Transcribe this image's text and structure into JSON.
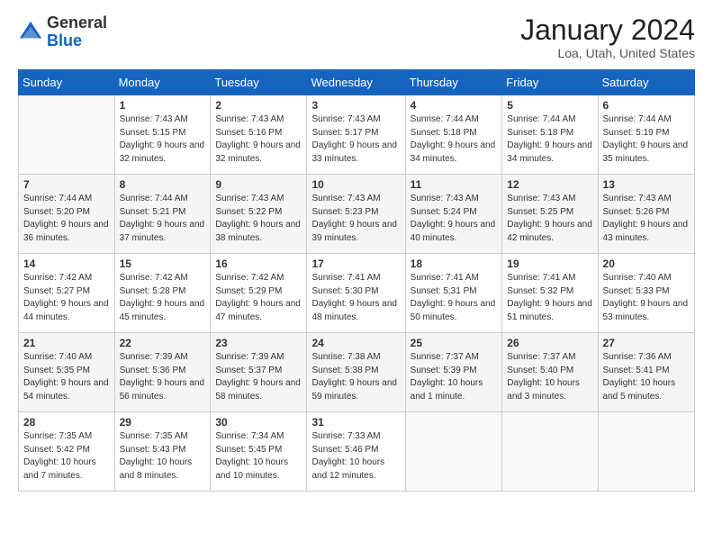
{
  "header": {
    "logo_general": "General",
    "logo_blue": "Blue",
    "month_title": "January 2024",
    "location": "Loa, Utah, United States"
  },
  "days_of_week": [
    "Sunday",
    "Monday",
    "Tuesday",
    "Wednesday",
    "Thursday",
    "Friday",
    "Saturday"
  ],
  "weeks": [
    [
      {
        "day": "",
        "sunrise": "",
        "sunset": "",
        "daylight": ""
      },
      {
        "day": "1",
        "sunrise": "Sunrise: 7:43 AM",
        "sunset": "Sunset: 5:15 PM",
        "daylight": "Daylight: 9 hours and 32 minutes."
      },
      {
        "day": "2",
        "sunrise": "Sunrise: 7:43 AM",
        "sunset": "Sunset: 5:16 PM",
        "daylight": "Daylight: 9 hours and 32 minutes."
      },
      {
        "day": "3",
        "sunrise": "Sunrise: 7:43 AM",
        "sunset": "Sunset: 5:17 PM",
        "daylight": "Daylight: 9 hours and 33 minutes."
      },
      {
        "day": "4",
        "sunrise": "Sunrise: 7:44 AM",
        "sunset": "Sunset: 5:18 PM",
        "daylight": "Daylight: 9 hours and 34 minutes."
      },
      {
        "day": "5",
        "sunrise": "Sunrise: 7:44 AM",
        "sunset": "Sunset: 5:18 PM",
        "daylight": "Daylight: 9 hours and 34 minutes."
      },
      {
        "day": "6",
        "sunrise": "Sunrise: 7:44 AM",
        "sunset": "Sunset: 5:19 PM",
        "daylight": "Daylight: 9 hours and 35 minutes."
      }
    ],
    [
      {
        "day": "7",
        "sunrise": "Sunrise: 7:44 AM",
        "sunset": "Sunset: 5:20 PM",
        "daylight": "Daylight: 9 hours and 36 minutes."
      },
      {
        "day": "8",
        "sunrise": "Sunrise: 7:44 AM",
        "sunset": "Sunset: 5:21 PM",
        "daylight": "Daylight: 9 hours and 37 minutes."
      },
      {
        "day": "9",
        "sunrise": "Sunrise: 7:43 AM",
        "sunset": "Sunset: 5:22 PM",
        "daylight": "Daylight: 9 hours and 38 minutes."
      },
      {
        "day": "10",
        "sunrise": "Sunrise: 7:43 AM",
        "sunset": "Sunset: 5:23 PM",
        "daylight": "Daylight: 9 hours and 39 minutes."
      },
      {
        "day": "11",
        "sunrise": "Sunrise: 7:43 AM",
        "sunset": "Sunset: 5:24 PM",
        "daylight": "Daylight: 9 hours and 40 minutes."
      },
      {
        "day": "12",
        "sunrise": "Sunrise: 7:43 AM",
        "sunset": "Sunset: 5:25 PM",
        "daylight": "Daylight: 9 hours and 42 minutes."
      },
      {
        "day": "13",
        "sunrise": "Sunrise: 7:43 AM",
        "sunset": "Sunset: 5:26 PM",
        "daylight": "Daylight: 9 hours and 43 minutes."
      }
    ],
    [
      {
        "day": "14",
        "sunrise": "Sunrise: 7:42 AM",
        "sunset": "Sunset: 5:27 PM",
        "daylight": "Daylight: 9 hours and 44 minutes."
      },
      {
        "day": "15",
        "sunrise": "Sunrise: 7:42 AM",
        "sunset": "Sunset: 5:28 PM",
        "daylight": "Daylight: 9 hours and 45 minutes."
      },
      {
        "day": "16",
        "sunrise": "Sunrise: 7:42 AM",
        "sunset": "Sunset: 5:29 PM",
        "daylight": "Daylight: 9 hours and 47 minutes."
      },
      {
        "day": "17",
        "sunrise": "Sunrise: 7:41 AM",
        "sunset": "Sunset: 5:30 PM",
        "daylight": "Daylight: 9 hours and 48 minutes."
      },
      {
        "day": "18",
        "sunrise": "Sunrise: 7:41 AM",
        "sunset": "Sunset: 5:31 PM",
        "daylight": "Daylight: 9 hours and 50 minutes."
      },
      {
        "day": "19",
        "sunrise": "Sunrise: 7:41 AM",
        "sunset": "Sunset: 5:32 PM",
        "daylight": "Daylight: 9 hours and 51 minutes."
      },
      {
        "day": "20",
        "sunrise": "Sunrise: 7:40 AM",
        "sunset": "Sunset: 5:33 PM",
        "daylight": "Daylight: 9 hours and 53 minutes."
      }
    ],
    [
      {
        "day": "21",
        "sunrise": "Sunrise: 7:40 AM",
        "sunset": "Sunset: 5:35 PM",
        "daylight": "Daylight: 9 hours and 54 minutes."
      },
      {
        "day": "22",
        "sunrise": "Sunrise: 7:39 AM",
        "sunset": "Sunset: 5:36 PM",
        "daylight": "Daylight: 9 hours and 56 minutes."
      },
      {
        "day": "23",
        "sunrise": "Sunrise: 7:39 AM",
        "sunset": "Sunset: 5:37 PM",
        "daylight": "Daylight: 9 hours and 58 minutes."
      },
      {
        "day": "24",
        "sunrise": "Sunrise: 7:38 AM",
        "sunset": "Sunset: 5:38 PM",
        "daylight": "Daylight: 9 hours and 59 minutes."
      },
      {
        "day": "25",
        "sunrise": "Sunrise: 7:37 AM",
        "sunset": "Sunset: 5:39 PM",
        "daylight": "Daylight: 10 hours and 1 minute."
      },
      {
        "day": "26",
        "sunrise": "Sunrise: 7:37 AM",
        "sunset": "Sunset: 5:40 PM",
        "daylight": "Daylight: 10 hours and 3 minutes."
      },
      {
        "day": "27",
        "sunrise": "Sunrise: 7:36 AM",
        "sunset": "Sunset: 5:41 PM",
        "daylight": "Daylight: 10 hours and 5 minutes."
      }
    ],
    [
      {
        "day": "28",
        "sunrise": "Sunrise: 7:35 AM",
        "sunset": "Sunset: 5:42 PM",
        "daylight": "Daylight: 10 hours and 7 minutes."
      },
      {
        "day": "29",
        "sunrise": "Sunrise: 7:35 AM",
        "sunset": "Sunset: 5:43 PM",
        "daylight": "Daylight: 10 hours and 8 minutes."
      },
      {
        "day": "30",
        "sunrise": "Sunrise: 7:34 AM",
        "sunset": "Sunset: 5:45 PM",
        "daylight": "Daylight: 10 hours and 10 minutes."
      },
      {
        "day": "31",
        "sunrise": "Sunrise: 7:33 AM",
        "sunset": "Sunset: 5:46 PM",
        "daylight": "Daylight: 10 hours and 12 minutes."
      },
      {
        "day": "",
        "sunrise": "",
        "sunset": "",
        "daylight": ""
      },
      {
        "day": "",
        "sunrise": "",
        "sunset": "",
        "daylight": ""
      },
      {
        "day": "",
        "sunrise": "",
        "sunset": "",
        "daylight": ""
      }
    ]
  ]
}
